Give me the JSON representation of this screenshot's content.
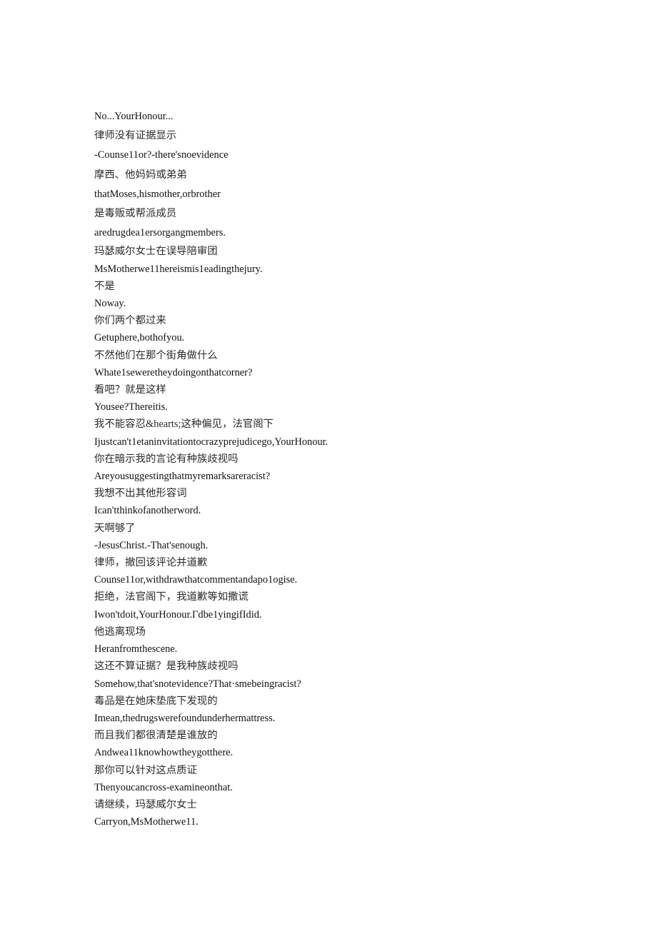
{
  "document": {
    "type": "bilingual-subtitle-transcript",
    "background_color": "#ffffff",
    "text_color": "#1a1a1a",
    "lines": [
      {
        "lang": "en",
        "text": "No...YourHonour..."
      },
      {
        "lang": "zh",
        "text": "律师没有证据显示"
      },
      {
        "lang": "en",
        "text": "-Counse11or?-there'snoevidence"
      },
      {
        "lang": "zh",
        "text": "摩西、他妈妈或弟弟"
      },
      {
        "lang": "en",
        "text": "thatMoses,hismother,orbrother"
      },
      {
        "lang": "zh",
        "text": "是毒贩或帮派成员"
      },
      {
        "lang": "en",
        "text": "aredrugdea1ersorgangmembers."
      },
      {
        "lang": "zh",
        "text": "玛瑟威尔女士在误导陪审团"
      },
      {
        "lang": "en",
        "text": "MsMotherwe11hereismis1eadingthejury."
      },
      {
        "lang": "zh",
        "text": "不是"
      },
      {
        "lang": "en",
        "text": "Noway."
      },
      {
        "lang": "zh",
        "text": "你们两个都过来"
      },
      {
        "lang": "en",
        "text": "Getuphere,bothofyou."
      },
      {
        "lang": "zh",
        "text": "不然他们在那个街角做什么"
      },
      {
        "lang": "en",
        "text": "Whate1seweretheydoingonthatcorner?"
      },
      {
        "lang": "zh",
        "text": "看吧？就是这样"
      },
      {
        "lang": "en",
        "text": "Yousee?Thereitis."
      },
      {
        "lang": "zh",
        "text": "我不能容忍&hearts;这种偏见，法官阁下"
      },
      {
        "lang": "en",
        "text": "Ijustcan't1etaninvitationtocrazyprejudicego,YourHonour."
      },
      {
        "lang": "zh",
        "text": "你在暗示我的言论有种族歧视吗"
      },
      {
        "lang": "en",
        "text": "Areyousuggestingthatmyremarksareracist?"
      },
      {
        "lang": "zh",
        "text": "我想不出其他形容词"
      },
      {
        "lang": "en",
        "text": "Ican'tthinkofanotherword."
      },
      {
        "lang": "zh",
        "text": "天啊够了"
      },
      {
        "lang": "en",
        "text": "-JesusChrist.-That'senough."
      },
      {
        "lang": "zh",
        "text": "律师，撤回该评论并道歉"
      },
      {
        "lang": "en",
        "text": "Counse11or,withdrawthatcommentandapo1ogise."
      },
      {
        "lang": "zh",
        "text": "拒绝，法官阁下，我道歉等如撒谎"
      },
      {
        "lang": "en",
        "text": "Iwon'tdoit,YourHonour.Гdbe1yingifIdid."
      },
      {
        "lang": "zh",
        "text": "他逃离现场"
      },
      {
        "lang": "en",
        "text": "Heranfromthescene."
      },
      {
        "lang": "zh",
        "text": "这还不算证据？是我种族歧视吗"
      },
      {
        "lang": "en",
        "text": "Somehow,that'snotevidence?That·smebeingracist?"
      },
      {
        "lang": "zh",
        "text": "毒品是在她床垫底下发现的"
      },
      {
        "lang": "en",
        "text": "Imean,thedrugswerefoundunderhermattress."
      },
      {
        "lang": "zh",
        "text": "而且我们都很清楚是谁放的"
      },
      {
        "lang": "en",
        "text": "Andwea11knowhowtheygotthere."
      },
      {
        "lang": "zh",
        "text": "那你可以针对这点质证"
      },
      {
        "lang": "en",
        "text": "Thenyoucancross-examineonthat."
      },
      {
        "lang": "zh",
        "text": "请继续，玛瑟威尔女士"
      },
      {
        "lang": "en",
        "text": "Carryon,MsMotherwe11."
      }
    ]
  }
}
